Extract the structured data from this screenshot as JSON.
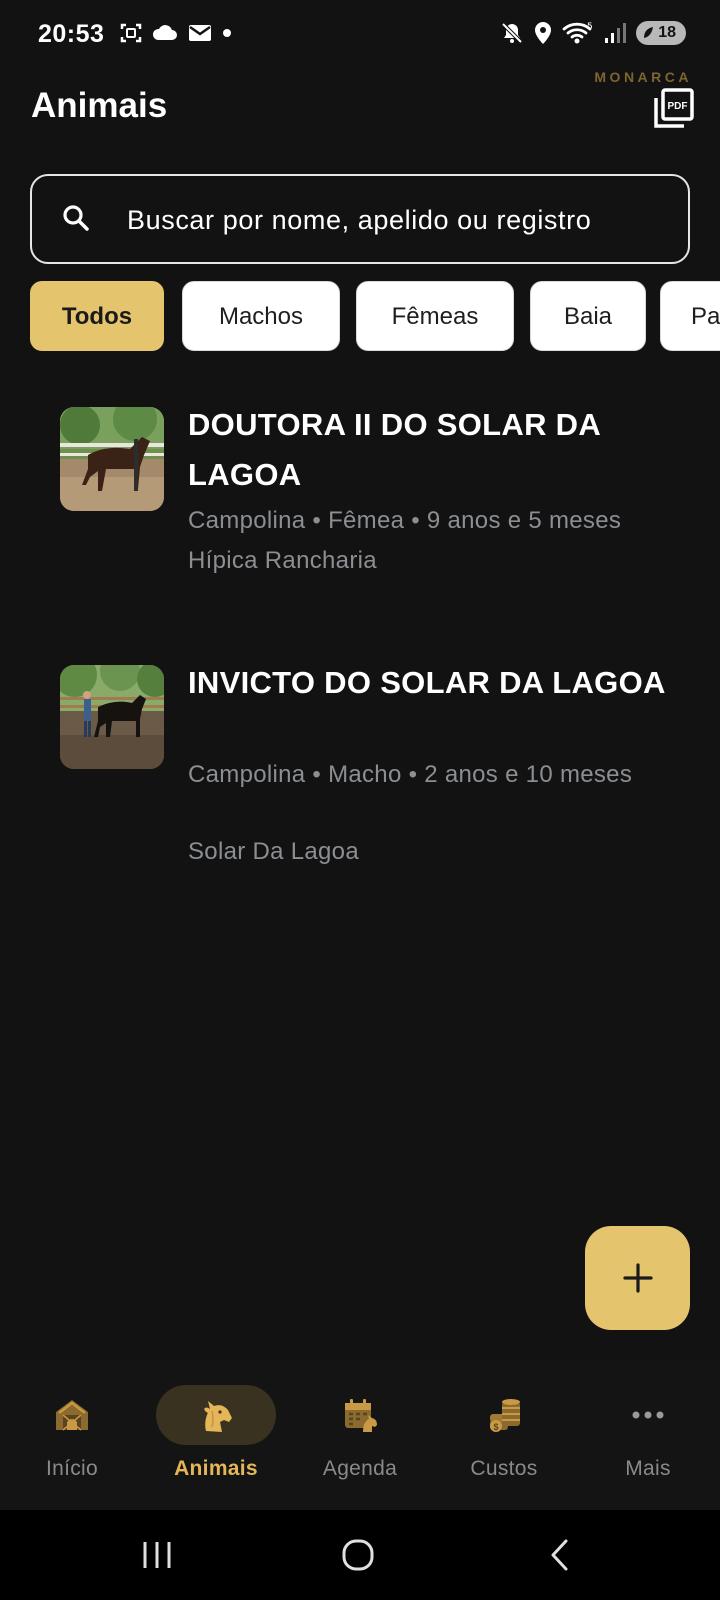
{
  "status_bar": {
    "time": "20:53",
    "battery": "18",
    "left_icons": [
      "screenshot-icon",
      "cloud-icon",
      "mail-icon",
      "dot-icon"
    ],
    "right_icons": [
      "mute-icon",
      "location-icon",
      "wifi-icon",
      "signal-icon",
      "battery-icon"
    ]
  },
  "header": {
    "title": "Animais",
    "brand": "MONARCA",
    "pdf_icon_label": "PDF"
  },
  "search": {
    "placeholder": "Buscar por nome, apelido ou registro",
    "value": ""
  },
  "filters": [
    {
      "label": "Todos",
      "active": true
    },
    {
      "label": "Machos",
      "active": false
    },
    {
      "label": "Fêmeas",
      "active": false
    },
    {
      "label": "Baia",
      "active": false
    },
    {
      "label": "Pa",
      "active": false
    }
  ],
  "animals": [
    {
      "name": "DOUTORA II DO SOLAR DA LAGOA",
      "details": "Campolina • Fêmea • 9 anos e 5 meses",
      "location": "Hípica Rancharia"
    },
    {
      "name": "INVICTO DO SOLAR DA LAGOA",
      "details": "Campolina • Macho • 2 anos e 10 meses",
      "location": "Solar Da Lagoa"
    }
  ],
  "fab": {
    "icon": "plus-icon"
  },
  "bottom_nav": [
    {
      "label": "Início",
      "icon": "stable-icon",
      "active": false
    },
    {
      "label": "Animais",
      "icon": "horse-head-icon",
      "active": true
    },
    {
      "label": "Agenda",
      "icon": "calendar-icon",
      "active": false
    },
    {
      "label": "Custos",
      "icon": "coins-icon",
      "active": false
    },
    {
      "label": "Mais",
      "icon": "more-icon",
      "active": false
    }
  ],
  "colors": {
    "background": "#121212",
    "accent": "#e5c46e",
    "nav_active_text": "#e5b657",
    "secondary_text": "#8b8e92"
  }
}
